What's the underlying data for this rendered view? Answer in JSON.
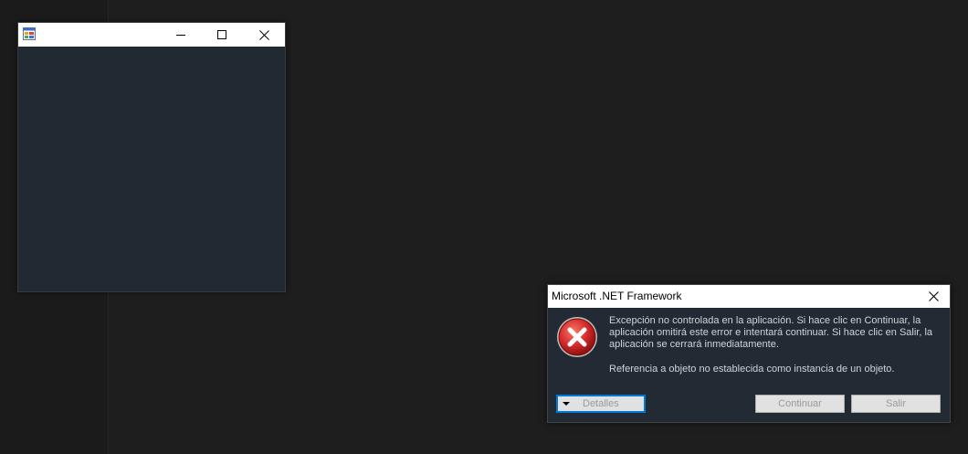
{
  "form_window": {
    "title": "",
    "app_icon": "winforms-app-icon",
    "minimize_icon": "minimize-icon",
    "maximize_icon": "maximize-icon",
    "close_icon": "close-icon"
  },
  "dialog": {
    "title": "Microsoft .NET Framework",
    "icon": "error-icon",
    "message": "Excepción no controlada en la aplicación. Si hace clic en Continuar, la aplicación omitirá este error e intentará continuar. Si hace clic en Salir, la aplicación se cerrará inmediatamente.",
    "detail": "Referencia a objeto no establecida como instancia de un objeto.",
    "buttons": {
      "details": "Detalles",
      "continue": "Continuar",
      "exit": "Salir"
    }
  },
  "colors": {
    "background": "#1e1e1e",
    "dialog_body": "#222a33",
    "focus_border": "#0078d7",
    "error_red": "#d42a2a"
  }
}
